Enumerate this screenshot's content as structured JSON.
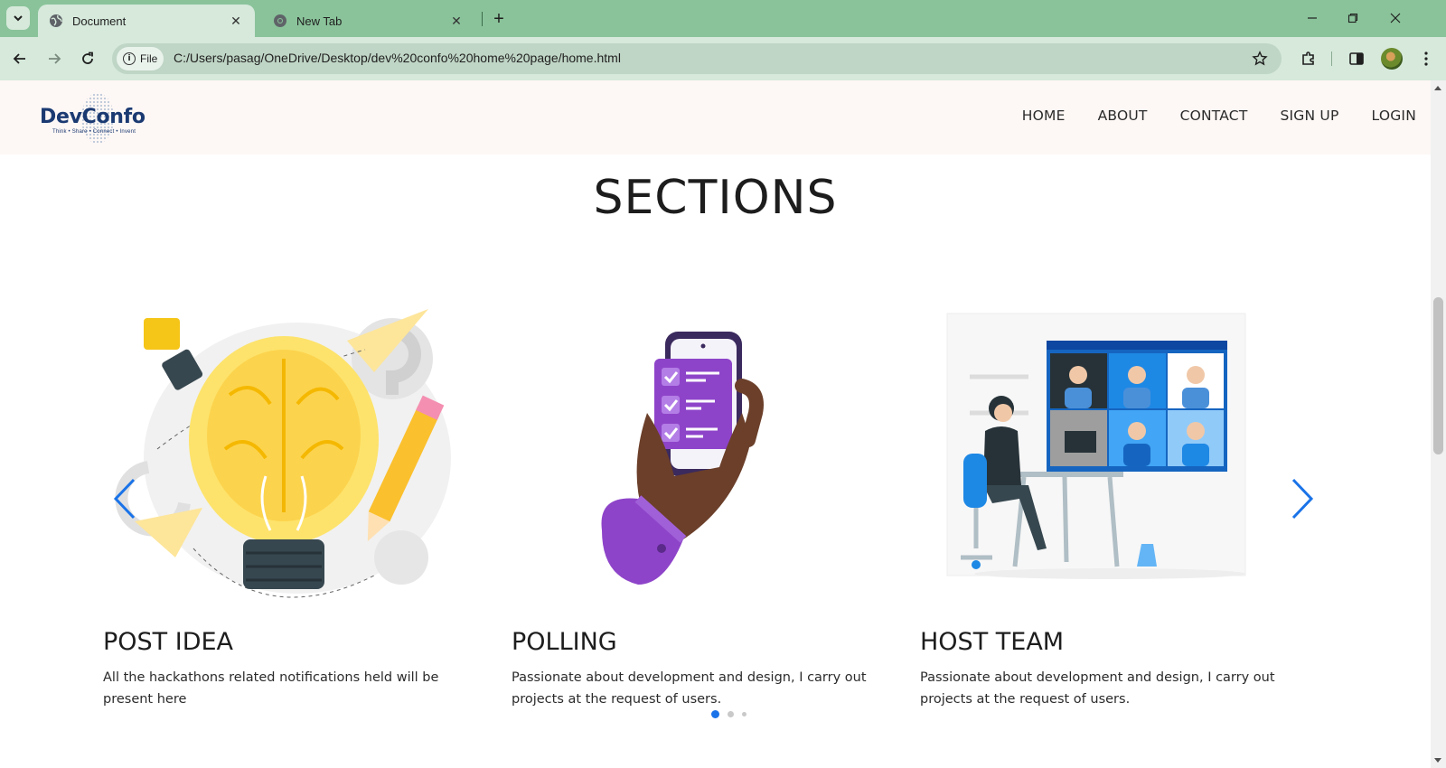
{
  "browser": {
    "tabs": [
      {
        "title": "Document",
        "active": true,
        "favicon": "globe-icon"
      },
      {
        "title": "New Tab",
        "active": false,
        "favicon": "chrome-icon"
      }
    ],
    "site_chip": "File",
    "url": "C:/Users/pasag/OneDrive/Desktop/dev%20confo%20home%20page/home.html"
  },
  "site": {
    "logo": {
      "name": "DevConfo",
      "tagline": "Think • Share • Connect • Invent"
    },
    "nav": [
      "HOME",
      "ABOUT",
      "CONTACT",
      "SIGN UP",
      "LOGIN"
    ]
  },
  "section": {
    "title": "SECTIONS",
    "cards": [
      {
        "title": "POST IDEA",
        "text": "All the hackathons related notifications held will be present here",
        "image": "brain-lightbulb-illustration"
      },
      {
        "title": "POLLING",
        "text": "Passionate about development and design, I carry out projects at the request of users.",
        "image": "phone-checklist-illustration"
      },
      {
        "title": "HOST TEAM",
        "text": "Passionate about development and design, I carry out projects at the request of users.",
        "image": "video-meeting-illustration"
      }
    ],
    "carousel": {
      "pages": 3,
      "active": 0
    }
  },
  "colors": {
    "accent": "#1a73e8",
    "logo": "#1b3a72",
    "chrome": "#8ac39a",
    "toolbar": "#d6e9db"
  }
}
